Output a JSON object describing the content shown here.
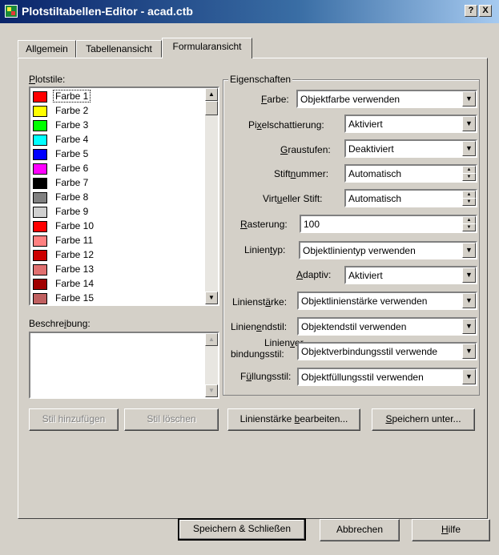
{
  "window": {
    "title": "Plotstiltabellen-Editor - acad.ctb",
    "help_btn": "?",
    "close_btn": "X"
  },
  "tabs": [
    {
      "label": "Allgemein"
    },
    {
      "label": "Tabellenansicht"
    },
    {
      "label": "Formularansicht",
      "active": true
    }
  ],
  "plotstile": {
    "label_u": "P",
    "label_rest": "lotstile:",
    "items": [
      {
        "label": "Farbe 1",
        "color": "#ff0000",
        "selected": true
      },
      {
        "label": "Farbe 2",
        "color": "#ffff00"
      },
      {
        "label": "Farbe 3",
        "color": "#00ff00"
      },
      {
        "label": "Farbe 4",
        "color": "#00ffff"
      },
      {
        "label": "Farbe 5",
        "color": "#0000ff"
      },
      {
        "label": "Farbe 6",
        "color": "#ff00ff"
      },
      {
        "label": "Farbe 7",
        "color": "#000000"
      },
      {
        "label": "Farbe 8",
        "color": "#808080"
      },
      {
        "label": "Farbe 9",
        "color": "#d0d0d0"
      },
      {
        "label": "Farbe 10",
        "color": "#ff0000"
      },
      {
        "label": "Farbe 11",
        "color": "#ff8080"
      },
      {
        "label": "Farbe 12",
        "color": "#cc0000"
      },
      {
        "label": "Farbe 13",
        "color": "#e07070"
      },
      {
        "label": "Farbe 14",
        "color": "#a00000"
      },
      {
        "label": "Farbe 15",
        "color": "#c06060"
      }
    ]
  },
  "beschreibung": {
    "label_pre": "Beschre",
    "label_u": "i",
    "label_rest": "bung:",
    "value": ""
  },
  "eigenschaften": {
    "title": "Eigenschaften",
    "farbe": {
      "label_u": "F",
      "label_rest": "arbe:",
      "value": "Objektfarbe verwenden"
    },
    "pixelschattierung": {
      "label_pre": "Pi",
      "label_u": "x",
      "label_rest": "elschattierung:",
      "value": "Aktiviert"
    },
    "graustufen": {
      "label_u": "G",
      "label_rest": "raustufen:",
      "value": "Deaktiviert"
    },
    "stiftnummer": {
      "label_pre": "Stift",
      "label_u": "n",
      "label_rest": "ummer:",
      "value": "Automatisch"
    },
    "virtueller_stift": {
      "label_pre": "Virt",
      "label_u": "u",
      "label_rest": "eller Stift:",
      "value": "Automatisch"
    },
    "rasterung": {
      "label_u": "R",
      "label_rest": "asterung:",
      "value": "100"
    },
    "linientyp": {
      "label_pre": "Linien",
      "label_u": "t",
      "label_rest": "yp:",
      "value": "Objektlinientyp verwenden"
    },
    "adaptiv": {
      "label_u": "A",
      "label_rest": "daptiv:",
      "value": "Aktiviert"
    },
    "linienstaerke": {
      "label_pre": "Linienst",
      "label_u": "ä",
      "label_rest": "rke:",
      "value": "Objektlinienstärke verwenden"
    },
    "linienendstil": {
      "label_pre": "Linien",
      "label_u": "e",
      "label_rest": "ndstil:",
      "value": "Objektendstil verwenden"
    },
    "linienverbindungsstil": {
      "label_line1_pre": "Linien",
      "label_line1_u": "v",
      "label_line1_rest": "er-",
      "label_line2": "bindungsstil:",
      "value": "Objektverbindungsstil verwende"
    },
    "fuellungsstil": {
      "label_pre": "F",
      "label_u": "ü",
      "label_rest": "llungsstil:",
      "value": "Objektfüllungsstil verwenden"
    }
  },
  "buttons": {
    "stil_hinzufuegen": "Stil hinzufügen",
    "stil_loeschen": "Stil löschen",
    "linienstaerke_bearbeiten_pre": "Linienstärke ",
    "linienstaerke_bearbeiten_u": "b",
    "linienstaerke_bearbeiten_rest": "earbeiten...",
    "speichern_unter_u": "S",
    "speichern_unter_rest": "peichern unter...",
    "speichern_schliessen": "Speichern & Schließen",
    "abbrechen": "Abbrechen",
    "hilfe_u": "H",
    "hilfe_rest": "ilfe"
  }
}
